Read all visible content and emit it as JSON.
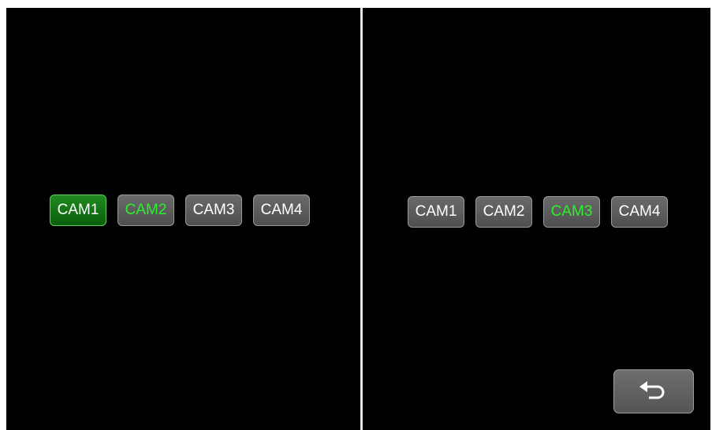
{
  "left_pane": {
    "cameras": [
      {
        "label": "CAM1",
        "state": "selected"
      },
      {
        "label": "CAM2",
        "state": "highlighted"
      },
      {
        "label": "CAM3",
        "state": "normal"
      },
      {
        "label": "CAM4",
        "state": "normal"
      }
    ]
  },
  "right_pane": {
    "cameras": [
      {
        "label": "CAM1",
        "state": "normal"
      },
      {
        "label": "CAM2",
        "state": "normal"
      },
      {
        "label": "CAM3",
        "state": "highlighted"
      },
      {
        "label": "CAM4",
        "state": "normal"
      }
    ],
    "back_button": {
      "icon": "return-arrow-icon"
    }
  },
  "colors": {
    "background": "#000000",
    "divider": "#e6e6e6",
    "button_gray": "#5c5c5c",
    "selected_green": "#137313",
    "highlight_text_green": "#2cf02c"
  }
}
